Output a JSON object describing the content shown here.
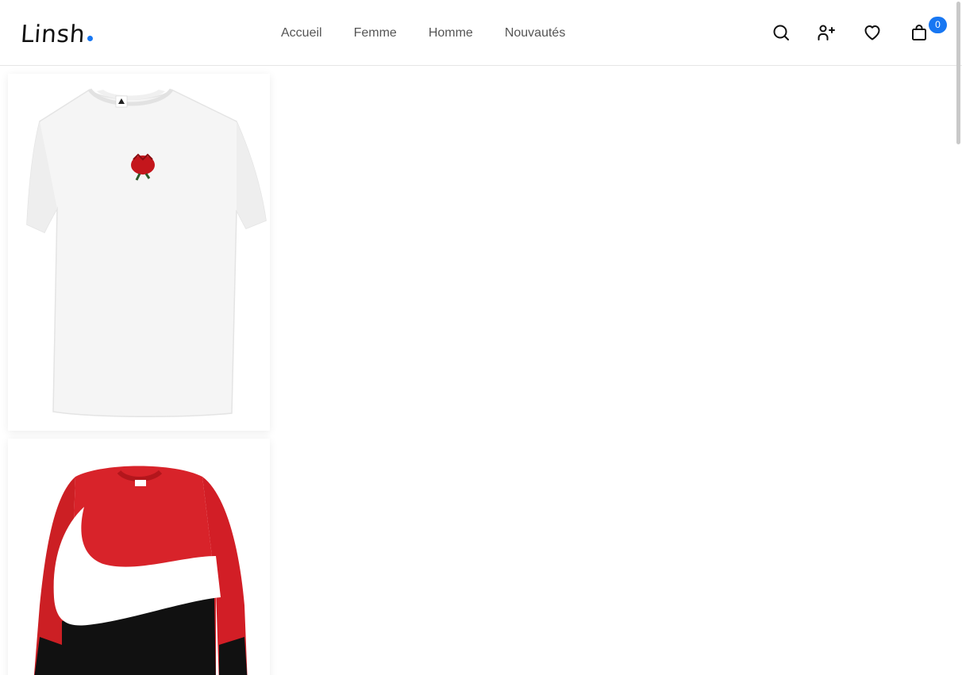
{
  "brand": {
    "name": "Linsh",
    "accent": "#1877f2"
  },
  "nav": {
    "items": [
      {
        "label": "Accueil"
      },
      {
        "label": "Femme"
      },
      {
        "label": "Homme"
      },
      {
        "label": "Nouvautés"
      }
    ]
  },
  "actions": {
    "search_icon": "search-icon",
    "register_icon": "user-plus-icon",
    "wishlist_icon": "heart-icon",
    "cart_icon": "shopping-bag-icon",
    "cart_count": "0"
  },
  "products": [
    {
      "image": "white-tshirt-with-rose-patch"
    },
    {
      "image": "red-white-black-sweatshirt-with-swoosh"
    }
  ]
}
